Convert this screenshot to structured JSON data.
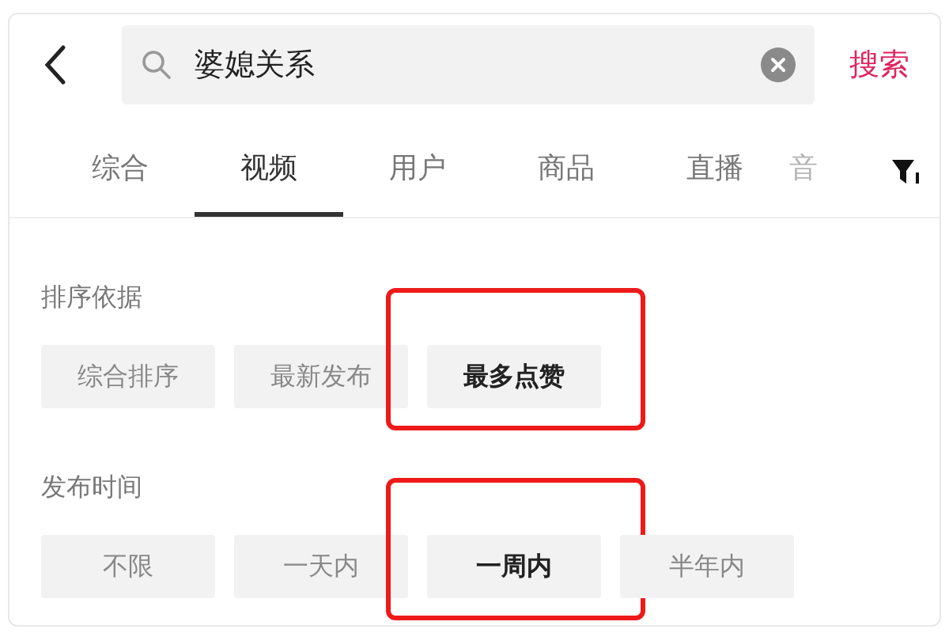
{
  "search": {
    "value": "婆媳关系",
    "button": "搜索"
  },
  "tabs": [
    {
      "label": "综合",
      "selected": false
    },
    {
      "label": "视频",
      "selected": true
    },
    {
      "label": "用户",
      "selected": false
    },
    {
      "label": "商品",
      "selected": false
    },
    {
      "label": "直播",
      "selected": false
    },
    {
      "label": "音",
      "selected": false,
      "faded": true
    }
  ],
  "filters": [
    {
      "title": "排序依据",
      "options": [
        {
          "label": "综合排序",
          "selected": false,
          "annotated": false
        },
        {
          "label": "最新发布",
          "selected": false,
          "annotated": false
        },
        {
          "label": "最多点赞",
          "selected": true,
          "annotated": true
        }
      ]
    },
    {
      "title": "发布时间",
      "options": [
        {
          "label": "不限",
          "selected": false,
          "annotated": false
        },
        {
          "label": "一天内",
          "selected": false,
          "annotated": false
        },
        {
          "label": "一周内",
          "selected": true,
          "annotated": true
        },
        {
          "label": "半年内",
          "selected": false,
          "annotated": false
        }
      ]
    }
  ]
}
